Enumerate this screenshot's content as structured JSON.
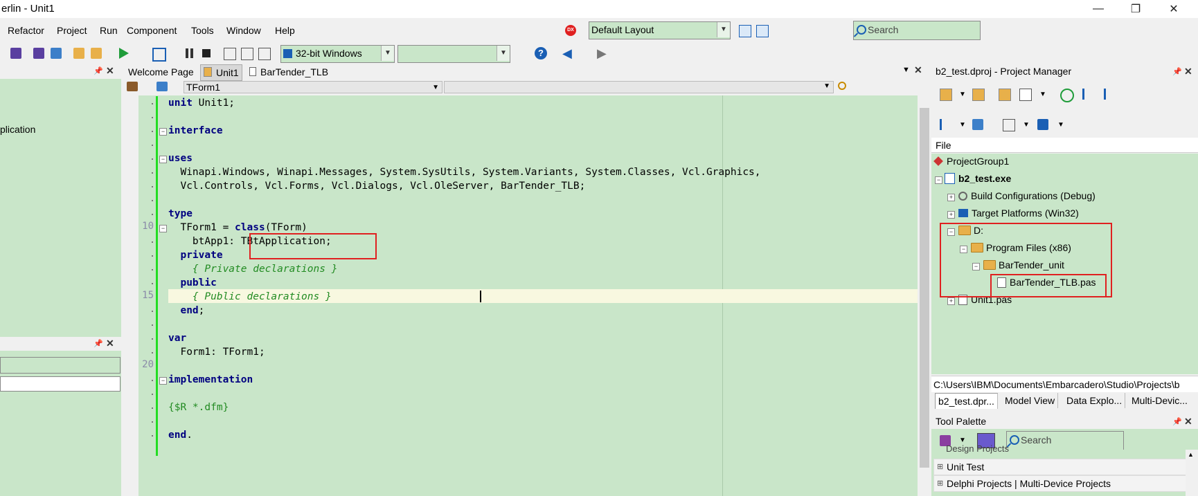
{
  "window": {
    "title": "erlin - Unit1",
    "controls": {
      "minimize": "—",
      "maximize": "❐",
      "close": "✕"
    }
  },
  "menubar": {
    "items": [
      "Refactor",
      "Project",
      "Run",
      "Component",
      "Tools",
      "Window",
      "Help"
    ],
    "layout_combo": "Default Layout",
    "search_placeholder": "Search",
    "dx_badge": "DX"
  },
  "toolbar": {
    "platform": "32-bit Windows",
    "config_combo": ""
  },
  "left_panel": {
    "partial_text": "plication"
  },
  "editor": {
    "tabs": [
      "Welcome Page",
      "Unit1",
      "BarTender_TLB"
    ],
    "active_tab": "Unit1",
    "class_combo": "TForm1",
    "method_combo": "",
    "line_numbers": [
      "10",
      "15",
      "20"
    ],
    "lines": [
      [
        {
          "t": "unit",
          "c": "kw"
        },
        {
          "t": " Unit1;",
          "c": ""
        }
      ],
      [],
      [
        {
          "t": "interface",
          "c": "kw"
        }
      ],
      [],
      [
        {
          "t": "uses",
          "c": "kw"
        }
      ],
      [
        {
          "t": "  Winapi.Windows, Winapi.Messages, System.SysUtils, System.Variants, System.Classes, Vcl.Graphics,",
          "c": ""
        }
      ],
      [
        {
          "t": "  Vcl.Controls, Vcl.Forms, Vcl.Dialogs, Vcl.OleServer, BarTender_TLB;",
          "c": ""
        }
      ],
      [],
      [
        {
          "t": "type",
          "c": "kw"
        }
      ],
      [
        {
          "t": "  TForm1 = ",
          "c": ""
        },
        {
          "t": "class",
          "c": "kw"
        },
        {
          "t": "(TForm)",
          "c": ""
        }
      ],
      [
        {
          "t": "    btApp1: TBtApplication;",
          "c": ""
        }
      ],
      [
        {
          "t": "  ",
          "c": ""
        },
        {
          "t": "private",
          "c": "kw"
        }
      ],
      [
        {
          "t": "    { Private declarations }",
          "c": "cm"
        }
      ],
      [
        {
          "t": "  ",
          "c": ""
        },
        {
          "t": "public",
          "c": "kw"
        }
      ],
      [
        {
          "t": "    { Public declarations }",
          "c": "cm"
        }
      ],
      [
        {
          "t": "  ",
          "c": ""
        },
        {
          "t": "end",
          "c": "kw"
        },
        {
          "t": ";",
          "c": ""
        }
      ],
      [],
      [
        {
          "t": "var",
          "c": "kw"
        }
      ],
      [
        {
          "t": "  Form1: TForm1;",
          "c": ""
        }
      ],
      [],
      [
        {
          "t": "implementation",
          "c": "kw"
        }
      ],
      [],
      [
        {
          "t": "{$R *.dfm}",
          "c": "dir"
        }
      ],
      [],
      [
        {
          "t": "end",
          "c": "kw"
        },
        {
          "t": ".",
          "c": ""
        }
      ]
    ]
  },
  "project_manager": {
    "title": "b2_test.dproj - Project Manager",
    "column_header": "File",
    "tree": {
      "group": "ProjectGroup1",
      "project": "b2_test.exe",
      "build_configs": "Build Configurations (Debug)",
      "target_platforms": "Target Platforms (Win32)",
      "drive": "D:",
      "program_files": "Program Files (x86)",
      "bartender_unit": "BarTender_unit",
      "tlb_file": "BarTender_TLB.pas",
      "unit_file": "Unit1.pas"
    },
    "path": "C:\\Users\\IBM\\Documents\\Embarcadero\\Studio\\Projects\\b",
    "bottom_tabs": [
      "b2_test.dpr...",
      "Model View",
      "Data Explo...",
      "Multi-Devic..."
    ]
  },
  "tool_palette": {
    "title": "Tool Palette",
    "search_placeholder": "Search",
    "partial_category": "Design Projects",
    "categories": [
      "Unit Test",
      "Delphi Projects | Multi-Device Projects"
    ]
  },
  "colors": {
    "editor_bg": "#c9e6c9",
    "highlight_box": "#e02020",
    "keyword": "#000080",
    "comment": "#228b22",
    "change_bar": "#22dd22"
  }
}
